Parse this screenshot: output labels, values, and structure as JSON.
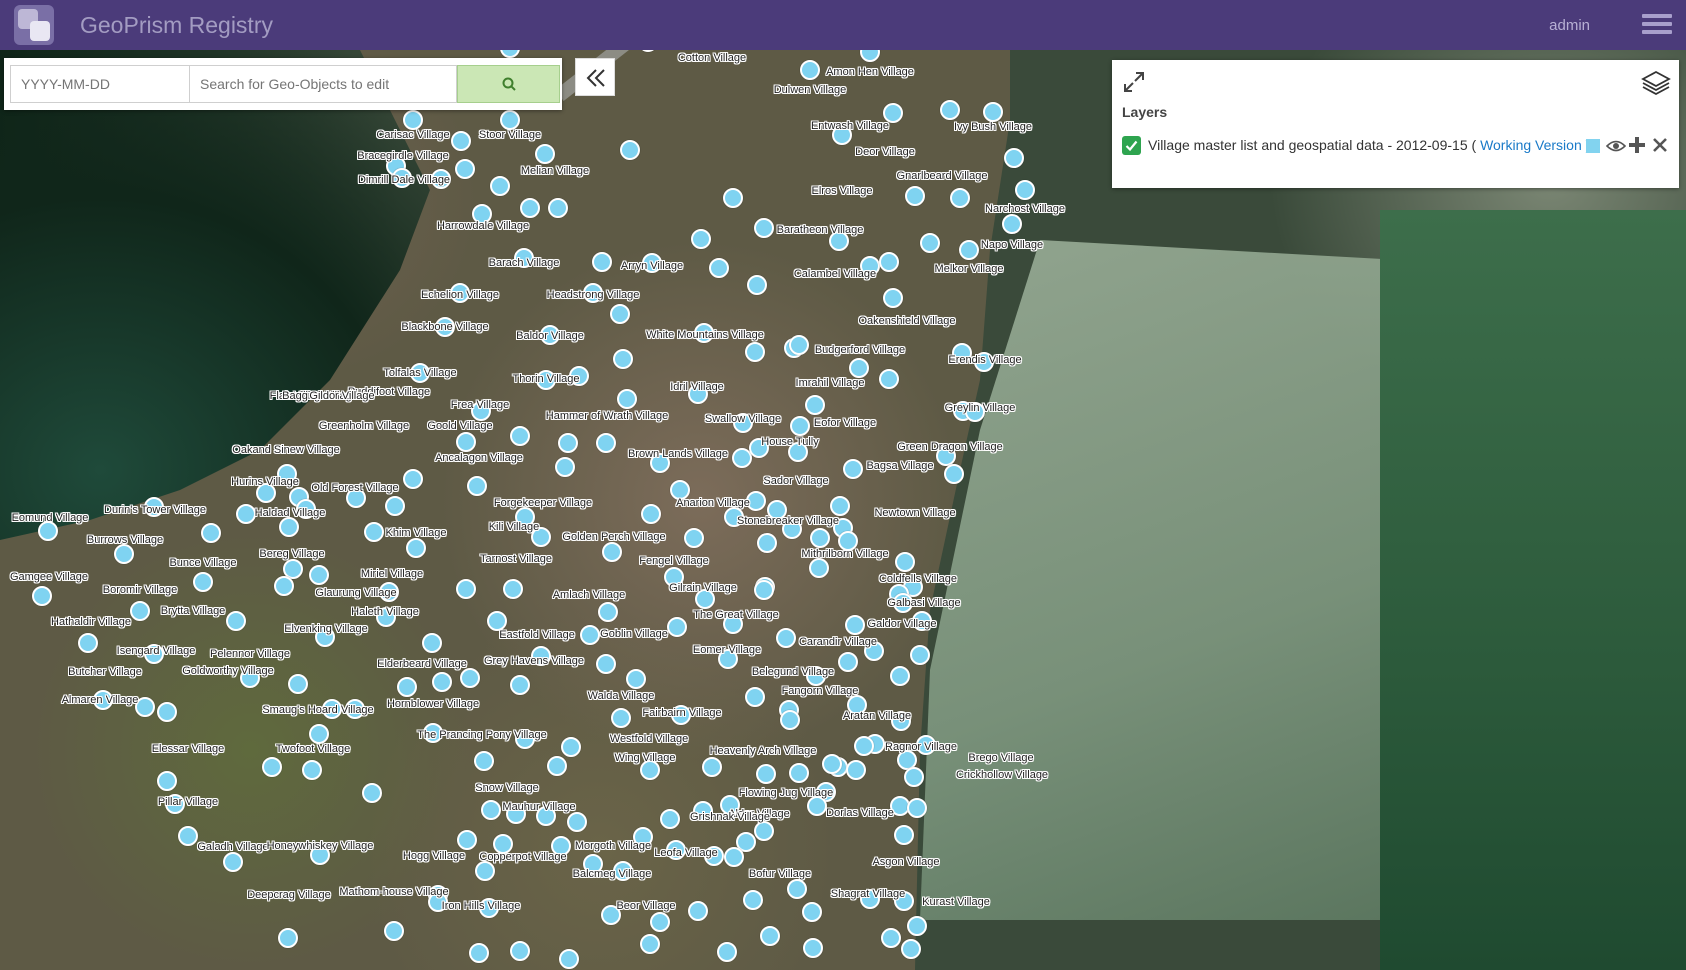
{
  "header": {
    "title": "GeoPrism Registry",
    "user": "admin"
  },
  "search": {
    "date_placeholder": "YYYY-MM-DD",
    "placeholder": "Search for Geo-Objects to edit"
  },
  "layers": {
    "title": "Layers",
    "items": [
      {
        "name": "Village master list and geospatial data - 2012-09-15 ( ",
        "version_link": "Working Version",
        "suffix": " )",
        "checked": true,
        "color": "#82d3ef"
      }
    ]
  },
  "map": {
    "marker_color": "#7fd3f1",
    "villages": [
      "Cotton Village",
      "Amon Hen Village",
      "Dulwen Village",
      "Carisac Village",
      "Stoor Village",
      "Entwash Village",
      "Ivy Bush Village",
      "Bracegirdle Village",
      "Deor Village",
      "Melian Village",
      "Gnarlbeard Village",
      "Dimrill Dale Village",
      "Elros Village",
      "Narchost Village",
      "Harrowdale Village",
      "Baratheon Village",
      "Barach Village",
      "Arryn Village",
      "Calambel Village",
      "Napo Village",
      "Melkor Village",
      "Echelion Village",
      "Headstrong Village",
      "Oakenshield Village",
      "Blackbone Village",
      "Baldor Village",
      "White Mountains Village",
      "Budgerford Village",
      "Erendis Village",
      "Tolfalas Village",
      "Thorin Village",
      "Imrahil Village",
      "Puddifoot Village",
      "Idril Village",
      "Frea Village",
      "Hammer of Wrath Village",
      "Swallow Village",
      "Eofor Village",
      "Greylin Village",
      "Greenholm Village",
      "Goold Village",
      "House Tully",
      "Green Dragon Village",
      "Oakand Sinew Village",
      "Ancalagon Village",
      "Brown Lands Village",
      "Bagsa Village",
      "Hurins Village",
      "Old Forest Village",
      "Sador Village",
      "Durin's Tower Village",
      "Haldad Village",
      "Forgekeeper Village",
      "Anarion Village",
      "Newtown Village",
      "Eomund Village",
      "Kili Village",
      "Stonebreaker Village",
      "Burrows Village",
      "Khim Village",
      "Golden Perch Village",
      "Bunce Village",
      "Bereg Village",
      "Tarnost Village",
      "Fengel Village",
      "Mithrilborn Village",
      "Gamgee Village",
      "Miriel Village",
      "Coldfells Village",
      "Boromir Village",
      "Glaurung Village",
      "Amlach Village",
      "Gilrain Village",
      "Galbasi Village",
      "Brytta Village",
      "Haleth Village",
      "The Great Village",
      "Hathaldir Village",
      "Elvenking Village",
      "Eastfold Village",
      "Goblin Village",
      "Galdor Village",
      "Isengard Village",
      "Pelennor Village",
      "Carandir Village",
      "Eomer Village",
      "Butcher Village",
      "Goldworthy Village",
      "Elderbeard Village",
      "Grey Havens Village",
      "Belegund Village",
      "Fangorn Village",
      "Almaren Village",
      "Smaug's Hoard Village",
      "Hornblower Village",
      "Walda Village",
      "Aratan Village",
      "Fairbairn Village",
      "The Prancing Pony Village",
      "Westfold Village",
      "Ragnor Village",
      "Elessar Village",
      "Twofoot Village",
      "Heavenly Arch Village",
      "Wing Village",
      "Crickhollow Village",
      "Snow Village",
      "Flowing Jug Village",
      "Aldor Village",
      "Mauhur Village",
      "Pillar Village",
      "Dorlas Village",
      "Copperpot Village",
      "Morgoth Village",
      "Grishnak Village",
      "Galadh Village",
      "Honeywhiskey Village",
      "Hogg Village",
      "Leofa Village",
      "Asgon Village",
      "Brego Village",
      "Balcmeg Village",
      "Bofur Village",
      "Deepcrag Village",
      "Mathom-house Village",
      "Kurast Village",
      "Shagrat Village",
      "Iron Hills Village",
      "Beor Village",
      "Flak Village",
      "Baggins Village",
      "Gildor Village"
    ]
  }
}
